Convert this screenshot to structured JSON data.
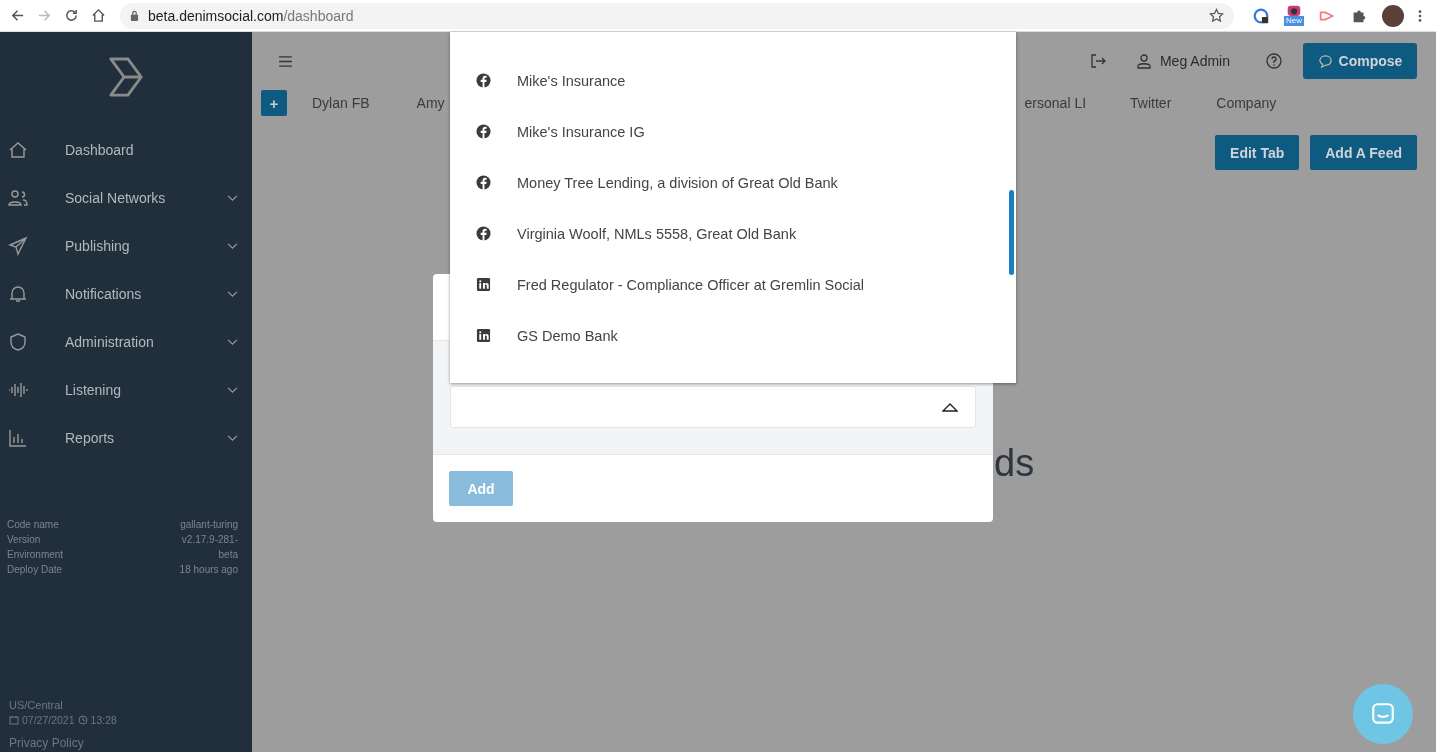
{
  "browser": {
    "url_host": "beta.denimsocial.com",
    "url_path": "/dashboard",
    "extension_badge": "New"
  },
  "sidebar": {
    "items": [
      {
        "label": "Dashboard",
        "has_submenu": false
      },
      {
        "label": "Social Networks",
        "has_submenu": true
      },
      {
        "label": "Publishing",
        "has_submenu": true
      },
      {
        "label": "Notifications",
        "has_submenu": true
      },
      {
        "label": "Administration",
        "has_submenu": true
      },
      {
        "label": "Listening",
        "has_submenu": true
      },
      {
        "label": "Reports",
        "has_submenu": true
      }
    ],
    "info": [
      {
        "label": "Code name",
        "value": "gallant-turing"
      },
      {
        "label": "Version",
        "value": "v2.17.9-281-"
      },
      {
        "label": "Environment",
        "value": "beta"
      },
      {
        "label": "Deploy Date",
        "value": "18 hours ago"
      }
    ],
    "timezone": "US/Central",
    "date": "07/27/2021",
    "time": "13:28",
    "privacy_link": "Privacy Policy"
  },
  "header": {
    "user": "Meg Admin",
    "compose": "Compose"
  },
  "tabs": [
    {
      "label": "Dylan FB"
    },
    {
      "label": "Amy"
    },
    {
      "label": "ersonal LI"
    },
    {
      "label": "Twitter"
    },
    {
      "label": "Company"
    }
  ],
  "tab_plus": "+",
  "actions": [
    "Edit Tab",
    "Add A Feed"
  ],
  "background_heading": "ds",
  "modal": {
    "add_button": "Add",
    "add_disabled": true
  },
  "dropdown": {
    "items": [
      {
        "kind": "facebook",
        "label": "Mike's Insurance"
      },
      {
        "kind": "facebook",
        "label": "Mike's Insurance IG"
      },
      {
        "kind": "facebook",
        "label": "Money Tree Lending, a division of Great Old Bank"
      },
      {
        "kind": "facebook",
        "label": "Virginia Woolf, NMLs 5558, Great Old Bank"
      },
      {
        "kind": "linkedin",
        "label": "Fred Regulator - Compliance Officer at Gremlin Social"
      },
      {
        "kind": "linkedin",
        "label": "GS Demo Bank"
      }
    ]
  }
}
